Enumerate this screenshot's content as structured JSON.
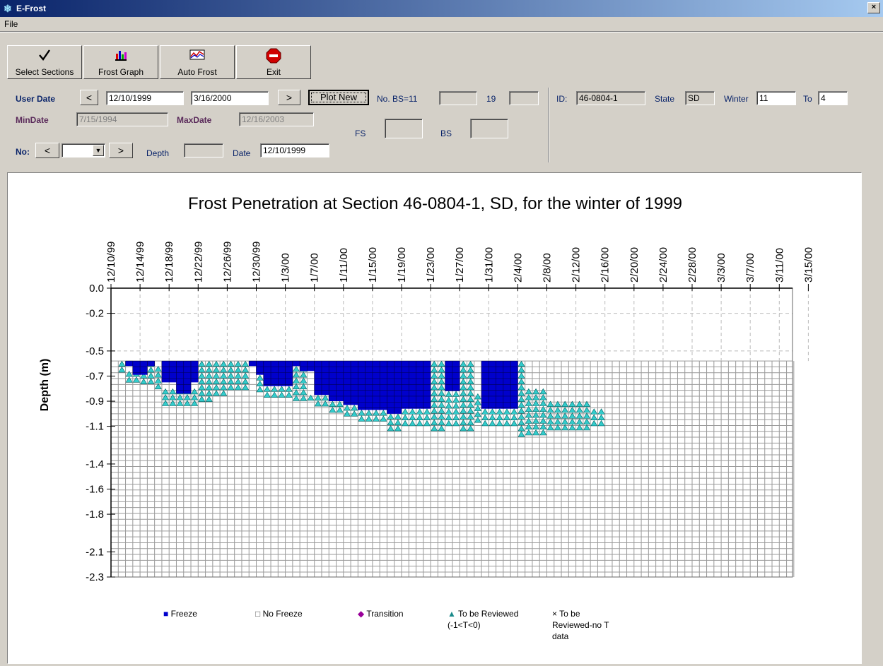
{
  "window": {
    "title": "E-Frost",
    "close_label": "×"
  },
  "menu": {
    "file_label": "File"
  },
  "toolbar": {
    "select_sections": "Select Sections",
    "frost_graph": "Frost Graph",
    "auto_frost": "Auto Frost",
    "exit": "Exit"
  },
  "controls": {
    "user_date_label": "User Date",
    "prev": "<",
    "next": ">",
    "user_date_from": "12/10/1999",
    "user_date_to": "3/16/2000",
    "plot_new": "Plot New",
    "no_bs_label": "No. BS=11",
    "no_bs_value": "",
    "count_label": "19",
    "count_value": "",
    "min_date_label": "MinDate",
    "min_date": "7/15/1994",
    "max_date_label": "MaxDate",
    "max_date": "12/16/2003",
    "fs_label": "FS",
    "fs_value": "",
    "bs_label": "BS",
    "bs_value": "",
    "no_label": "No:",
    "no_value": "",
    "depth_label": "Depth",
    "depth_value": "",
    "date_label": "Date",
    "date_value": "12/10/1999",
    "id_label": "ID:",
    "id_value": "46-0804-1",
    "state_label": "State",
    "state_value": "SD",
    "winter_label": "Winter",
    "winter_value": "11",
    "to_label": "To",
    "to_value": "4"
  },
  "chart_data": {
    "type": "heatmap",
    "title": "Frost Penetration at Section 46-0804-1, SD, for the winter of 1999",
    "ylabel": "Depth (m)",
    "xlabel": "",
    "x_tick_labels": [
      "12/10/99",
      "12/14/99",
      "12/18/99",
      "12/22/99",
      "12/26/99",
      "12/30/99",
      "1/3/00",
      "1/7/00",
      "1/11/00",
      "1/15/00",
      "1/19/00",
      "1/23/00",
      "1/27/00",
      "1/31/00",
      "2/4/00",
      "2/8/00",
      "2/12/00",
      "2/16/00",
      "2/20/00",
      "2/24/00",
      "2/28/00",
      "3/3/00",
      "3/7/00",
      "3/11/00",
      "3/15/00"
    ],
    "y_tick_labels": [
      "0.0",
      "-0.2",
      "-0.5",
      "-0.7",
      "-0.9",
      "-1.1",
      "-1.4",
      "-1.6",
      "-1.8",
      "-2.1",
      "-2.3"
    ],
    "ylim": [
      -2.3,
      0.0
    ],
    "x_range": [
      "12/10/99",
      "3/16/00"
    ],
    "grid": true,
    "legend_position": "bottom",
    "colors": {
      "freeze": "#0000cc",
      "no_freeze": "#ffffff",
      "transition": "#990099",
      "review": "#33cccc",
      "grid": "#9a9a9a"
    },
    "legend": [
      {
        "label": "Freeze",
        "symbol": "■"
      },
      {
        "label": "No Freeze",
        "symbol": "□"
      },
      {
        "label": "Transition",
        "symbol": "◆"
      },
      {
        "label": "To be Reviewed (-1<T<0)",
        "symbol": "▲"
      },
      {
        "label": "To be Reviewed-no T data",
        "symbol": "×"
      }
    ],
    "sensor_depth_range_m": [
      -0.58,
      -2.3
    ],
    "day_step": 1,
    "sequence_start": "12/10/99",
    "freeze_spans_by_day": [
      [
        2,
        3,
        -0.58,
        -0.62
      ],
      [
        3,
        5,
        -0.58,
        -0.69
      ],
      [
        5,
        6,
        -0.58,
        -0.62
      ],
      [
        7,
        9,
        -0.58,
        -0.75
      ],
      [
        9,
        11,
        -0.58,
        -0.84
      ],
      [
        11,
        12,
        -0.58,
        -0.75
      ],
      [
        19,
        20,
        -0.58,
        -0.62
      ],
      [
        20,
        21,
        -0.58,
        -0.69
      ],
      [
        21,
        25,
        -0.58,
        -0.78
      ],
      [
        25,
        26,
        -0.58,
        -0.62
      ],
      [
        26,
        28,
        -0.58,
        -0.66
      ],
      [
        28,
        30,
        -0.58,
        -0.85
      ],
      [
        30,
        32,
        -0.58,
        -0.9
      ],
      [
        32,
        34,
        -0.58,
        -0.93
      ],
      [
        34,
        38,
        -0.58,
        -0.97
      ],
      [
        38,
        40,
        -0.58,
        -1.0
      ],
      [
        40,
        44,
        -0.58,
        -0.96
      ],
      [
        46,
        48,
        -0.58,
        -0.82
      ],
      [
        51,
        56,
        -0.58,
        -0.96
      ]
    ],
    "review_spans_by_day": [
      [
        1,
        2,
        -0.58,
        -0.66
      ],
      [
        2,
        4,
        -0.66,
        -0.75
      ],
      [
        4,
        6,
        -0.58,
        -0.75
      ],
      [
        6,
        7,
        -0.62,
        -0.78
      ],
      [
        7,
        12,
        -0.8,
        -0.9
      ],
      [
        12,
        14,
        -0.58,
        -0.87
      ],
      [
        14,
        16,
        -0.58,
        -0.84
      ],
      [
        16,
        19,
        -0.58,
        -0.78
      ],
      [
        20,
        21,
        -0.69,
        -0.8
      ],
      [
        21,
        25,
        -0.78,
        -0.87
      ],
      [
        25,
        27,
        -0.62,
        -0.87
      ],
      [
        27,
        28,
        -0.85,
        -0.9
      ],
      [
        28,
        30,
        -0.85,
        -0.93
      ],
      [
        30,
        32,
        -0.9,
        -0.96
      ],
      [
        32,
        34,
        -0.93,
        -1.0
      ],
      [
        34,
        38,
        -0.97,
        -1.05
      ],
      [
        38,
        40,
        -1.0,
        -1.1
      ],
      [
        40,
        44,
        -0.96,
        -1.1
      ],
      [
        44,
        46,
        -0.58,
        -1.1
      ],
      [
        46,
        48,
        -0.82,
        -1.1
      ],
      [
        48,
        50,
        -0.58,
        -1.1
      ],
      [
        50,
        51,
        -0.84,
        -1.05
      ],
      [
        51,
        56,
        -0.96,
        -1.1
      ],
      [
        56,
        57,
        -0.58,
        -1.15
      ],
      [
        57,
        60,
        -0.8,
        -1.15
      ],
      [
        60,
        66,
        -0.9,
        -1.1
      ],
      [
        66,
        68,
        -0.96,
        -1.08
      ]
    ]
  }
}
